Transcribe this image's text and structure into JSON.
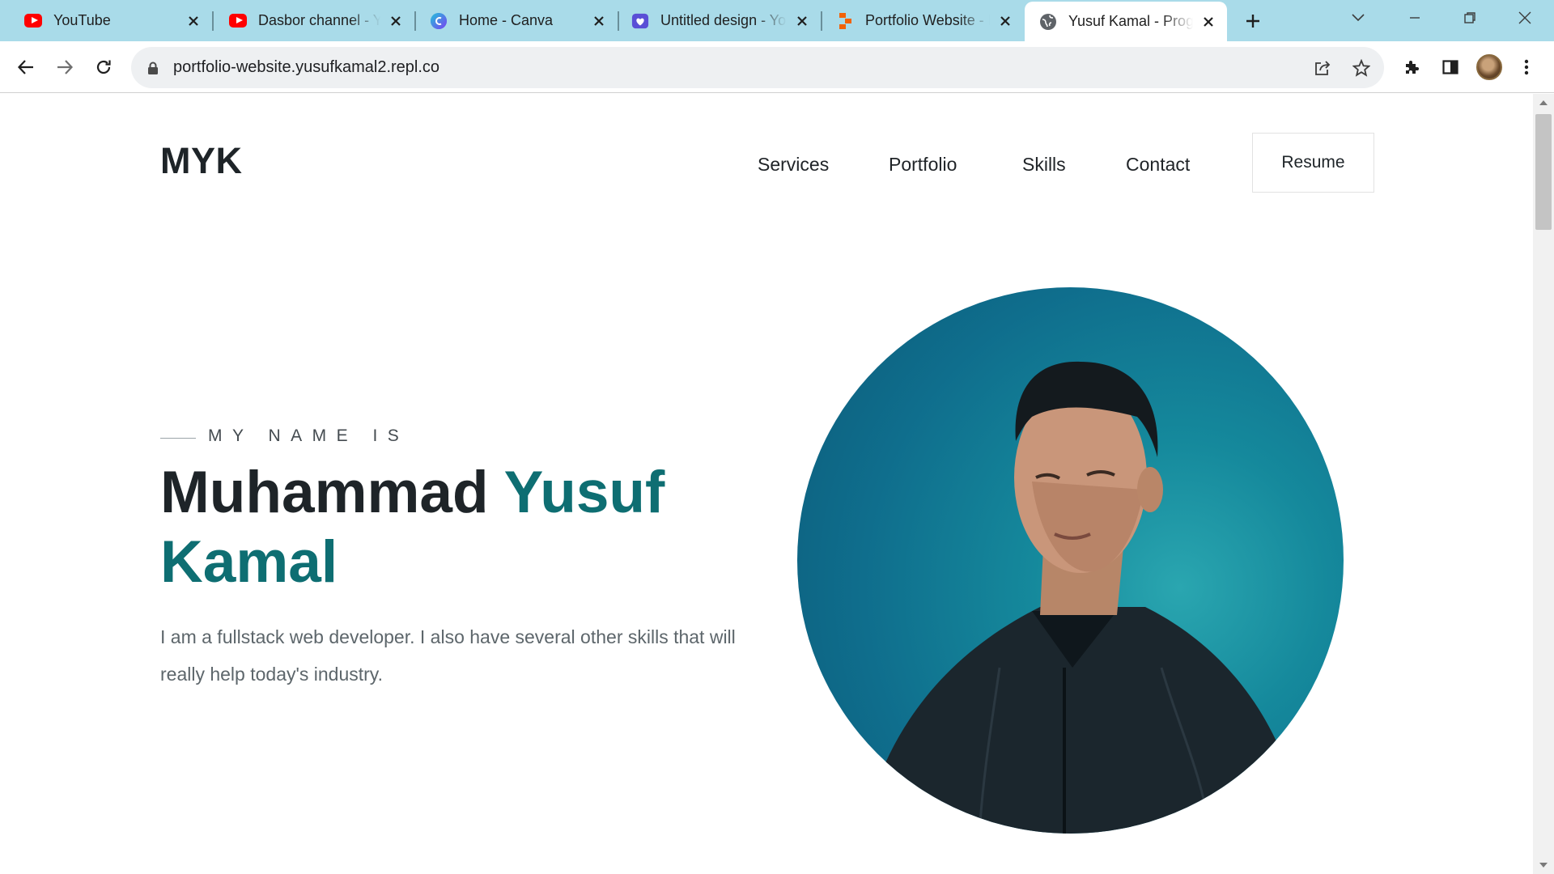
{
  "browser": {
    "tabs": [
      {
        "title": "YouTube",
        "icon": "youtube-icon",
        "active": false
      },
      {
        "title": "Dasbor channel - YouTube",
        "icon": "youtube-icon",
        "active": false
      },
      {
        "title": "Home - Canva",
        "icon": "canva-icon",
        "active": false
      },
      {
        "title": "Untitled design - YouTube",
        "icon": "heart-app-icon",
        "active": false
      },
      {
        "title": "Portfolio Website - Replit",
        "icon": "replit-icon",
        "active": false
      },
      {
        "title": "Yusuf Kamal - Programmer",
        "icon": "globe-icon",
        "active": true
      }
    ],
    "url": "portfolio-website.yusufkamal2.repl.co",
    "colors": {
      "tabstrip": "#a9dbe9",
      "youtube": "#ff0000",
      "canva": "#3b7cf5",
      "replit": "#f26207"
    }
  },
  "site": {
    "logo": "MYK",
    "nav": [
      "Services",
      "Portfolio",
      "Skills",
      "Contact"
    ],
    "resume_label": "Resume",
    "hero": {
      "eyebrow": "MY NAME IS",
      "name_first": "Muhammad",
      "name_accent": "Yusuf Kamal",
      "intro": "I am a fullstack web developer. I also have several other skills that will really help today's industry."
    },
    "colors": {
      "text": "#1e2428",
      "accent": "#0e6e72",
      "muted": "#5d666b",
      "photo_bg": "#0f6e8d"
    }
  }
}
